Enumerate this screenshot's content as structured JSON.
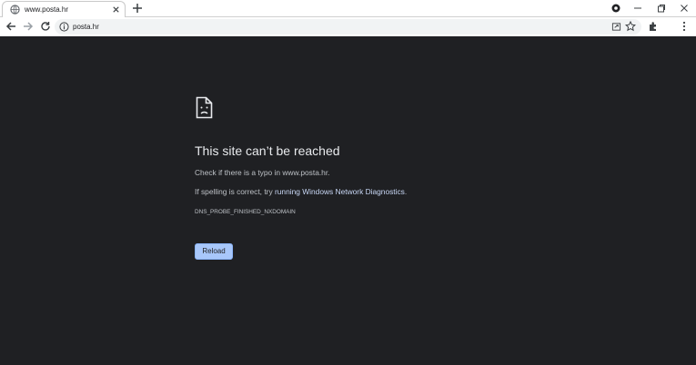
{
  "tab": {
    "title": "www.posta.hr",
    "icon": "globe-icon"
  },
  "omnibox": {
    "url": "posta.hr"
  },
  "page": {
    "heading": "This site can’t be reached",
    "line1": "Check if there is a typo in www.posta.hr.",
    "line2_prefix": "If spelling is correct, try ",
    "line2_link": "running Windows Network Diagnostics",
    "line2_suffix": ".",
    "error_code": "DNS_PROBE_FINISHED_NXDOMAIN",
    "reload_label": "Reload"
  },
  "colors": {
    "page_bg": "#1f2023",
    "button_bg": "#a8c7fa",
    "link": "#c8d7f5"
  }
}
